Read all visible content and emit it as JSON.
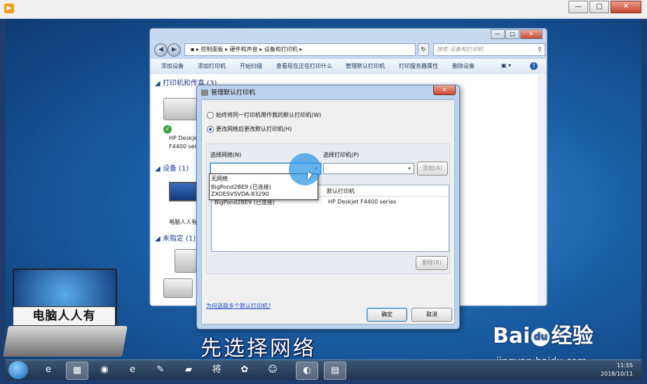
{
  "outer_window": {
    "controls": {
      "minimize": "—",
      "maximize": "□",
      "close": "✕"
    }
  },
  "explorer": {
    "address_items": [
      "控制面板",
      "硬件和声音",
      "设备和打印机"
    ],
    "search_placeholder": "搜索 设备和打印机",
    "toolbar": [
      "添加设备",
      "添加打印机",
      "开始扫描",
      "查看现在正在打印什么",
      "管理默认打印机",
      "打印服务器属性",
      "删除设备"
    ],
    "groups": [
      {
        "label": "打印机和传真 (3)"
      },
      {
        "label": "设备 (1)"
      },
      {
        "label": "未指定 (1)"
      }
    ],
    "printer_label_1": "HP Deskjet",
    "printer_label_2": "F4400 series",
    "device_label": "电脑人人有"
  },
  "dialog": {
    "title": "管理默认打印机",
    "radio_always": "始终将同一打印机用作我的默认打印机(W)",
    "radio_change": "更改网络后更改默认打印机(H)",
    "select_network_label": "选择网络(N)",
    "select_printer_label": "选择打印机(P)",
    "add_button": "添加(A)",
    "col_network": "",
    "col_default": "默认打印机",
    "row_network": "BigPond2BE9 (已连接)",
    "row_printer": "HP Deskjet F4400 series",
    "remove_button": "删除(R)",
    "link": "为何选取多个默认打印机?",
    "ok_button": "确定",
    "cancel_button": "取消",
    "dropdown_options": [
      "无网络",
      "BigPond2BE9 (已连接)",
      "ZXOESVSVDA-83290"
    ]
  },
  "overlay": {
    "caption": "先选择网络",
    "logo_text": "电脑人人有",
    "baidu_1": "Bai",
    "baidu_paw": "du",
    "baidu_2": "经验",
    "baidu_sub": "jingyan.baidu.com"
  },
  "taskbar": {
    "time": "11:55",
    "date": "2018/10/11"
  }
}
